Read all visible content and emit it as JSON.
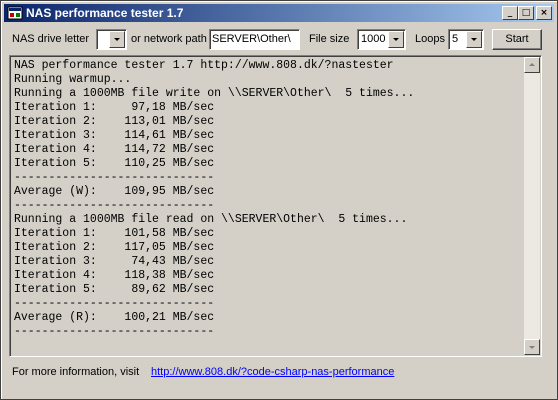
{
  "window": {
    "title": "NAS performance tester 1.7",
    "minimize": "_",
    "maximize": "□",
    "close": "×"
  },
  "toolbar": {
    "drive_letter_label": "NAS drive letter",
    "drive_letter_value": "",
    "network_path_label": "or network path",
    "network_path_value": "SERVER\\Other\\",
    "file_size_label": "File size",
    "file_size_value": "1000",
    "loops_label": "Loops",
    "loops_value": "5",
    "start_label": "Start"
  },
  "output": {
    "lines": [
      "NAS performance tester 1.7 http://www.808.dk/?nastester",
      "Running warmup...",
      "Running a 1000MB file write on \\\\SERVER\\Other\\  5 times...",
      "Iteration 1:     97,18 MB/sec",
      "Iteration 2:    113,01 MB/sec",
      "Iteration 3:    114,61 MB/sec",
      "Iteration 4:    114,72 MB/sec",
      "Iteration 5:    110,25 MB/sec",
      "-----------------------------",
      "Average (W):    109,95 MB/sec",
      "-----------------------------",
      "Running a 1000MB file read on \\\\SERVER\\Other\\  5 times...",
      "Iteration 1:    101,58 MB/sec",
      "Iteration 2:    117,05 MB/sec",
      "Iteration 3:     74,43 MB/sec",
      "Iteration 4:    118,38 MB/sec",
      "Iteration 5:     89,62 MB/sec",
      "-----------------------------",
      "Average (R):    100,21 MB/sec",
      "-----------------------------"
    ]
  },
  "footer": {
    "info_label": "For more information, visit",
    "link_text": "http://www.808.dk/?code-csharp-nas-performance"
  },
  "colors": {
    "title_gradient_start": "#0a246a",
    "title_gradient_end": "#a6caf0",
    "face": "#d4d0c8",
    "link": "#0000ff"
  }
}
